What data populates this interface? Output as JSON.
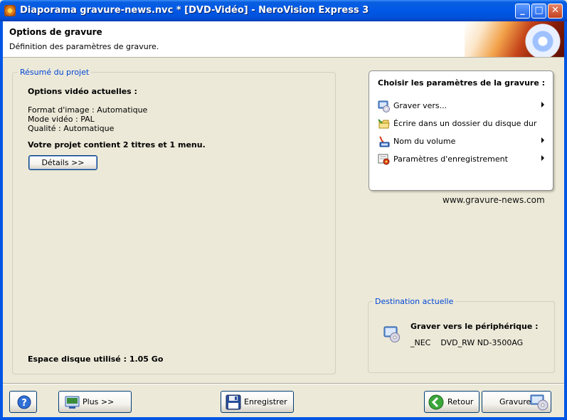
{
  "window": {
    "title": "Diaporama gravure-news.nvc * [DVD-Vidéo] - NeroVision Express 3",
    "min_glyph": "_",
    "max_glyph": "□",
    "close_glyph": "✕"
  },
  "header": {
    "title": "Options de gravure",
    "subtitle": "Définition des paramètres de gravure."
  },
  "summary": {
    "group_label": "Résumé du projet",
    "options_title": "Options vidéo actuelles :",
    "format": "Format d'image : Automatique",
    "mode": "Mode vidéo : PAL",
    "quality": "Qualité : Automatique",
    "project_info": "Votre projet contient 2 titres et 1 menu.",
    "details_button": "Détails >>",
    "disk_used": "Espace disque utilisé : 1.05 Go"
  },
  "burn_options": {
    "title": "Choisir les paramètres de la gravure :",
    "items": [
      {
        "label": "Graver vers...",
        "icon": "burn-to-icon",
        "has_submenu": true
      },
      {
        "label": "Écrire dans un dossier du disque dur",
        "icon": "folder-icon",
        "has_submenu": false
      },
      {
        "label": "Nom du volume",
        "icon": "volume-name-icon",
        "has_submenu": true
      },
      {
        "label": "Paramètres d'enregistrement",
        "icon": "record-settings-icon",
        "has_submenu": true
      }
    ]
  },
  "watermark": "www.gravure-news.com",
  "destination": {
    "group_label": "Destination actuelle",
    "heading": "Graver vers le périphérique :",
    "device": "_NEC    DVD_RW ND-3500AG"
  },
  "bottom_bar": {
    "help_icon": "help-icon",
    "plus_label": "Plus >>",
    "save_label": "Enregistrer",
    "back_label": "Retour",
    "burn_label": "Gravure"
  },
  "colors": {
    "titlebar": "#0058E6",
    "group_label": "#0046D5",
    "face": "#ECE9D8"
  }
}
